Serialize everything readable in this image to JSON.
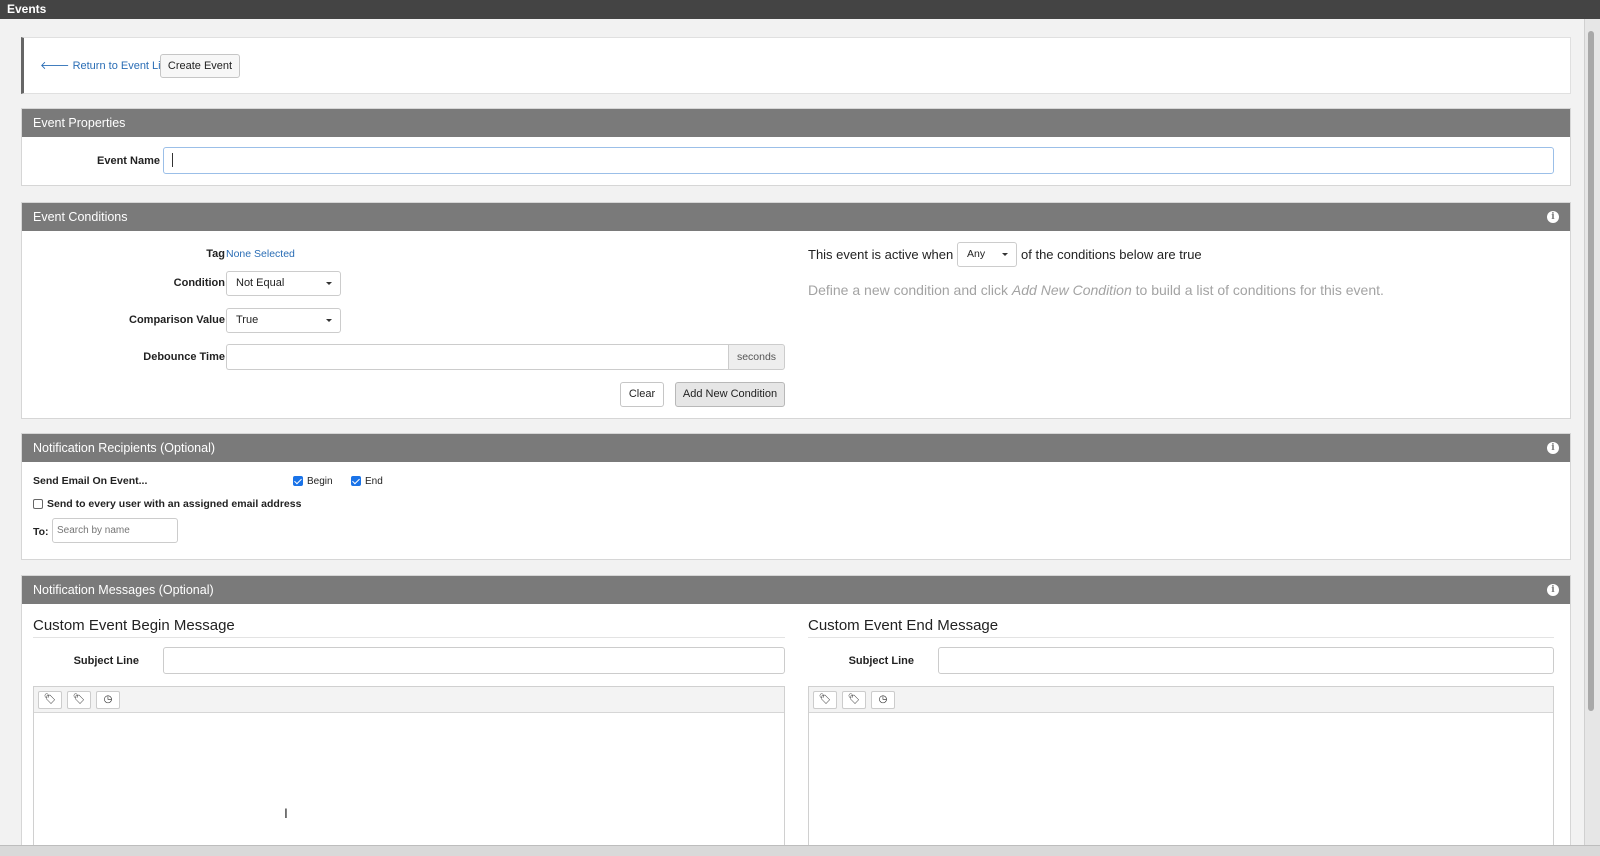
{
  "window": {
    "title": "Events"
  },
  "toolbar": {
    "back_link": "Return to Event List",
    "create_button": "Create Event"
  },
  "properties": {
    "header": "Event Properties",
    "event_name_label": "Event Name",
    "event_name_value": ""
  },
  "conditions": {
    "header": "Event Conditions",
    "tag_label": "Tag",
    "tag_value": "None Selected",
    "condition_label": "Condition",
    "condition_value": "Not Equal",
    "comparison_label": "Comparison Value",
    "comparison_value": "True",
    "debounce_label": "Debounce Time",
    "debounce_value": "",
    "debounce_unit": "seconds",
    "clear_button": "Clear",
    "add_button": "Add New Condition",
    "active_prefix": "This event is active when",
    "active_select": "Any",
    "active_suffix": "of the conditions below are true",
    "hint_prefix": "Define a new condition and click",
    "hint_emphasis": "Add New Condition",
    "hint_suffix": "to build a list of conditions for this event."
  },
  "recipients": {
    "header": "Notification Recipients (Optional)",
    "send_label": "Send Email On Event...",
    "begin_label": "Begin",
    "begin_checked": true,
    "end_label": "End",
    "end_checked": true,
    "every_user_label": "Send to every user with an assigned email address",
    "every_user_checked": false,
    "to_label": "To:",
    "to_placeholder": "Search by name"
  },
  "messages": {
    "header": "Notification Messages (Optional)",
    "begin_title": "Custom Event Begin Message",
    "end_title": "Custom Event End Message",
    "subject_label": "Subject Line",
    "editor_icons": [
      "tag-icon",
      "tags-icon",
      "clock-icon"
    ]
  }
}
